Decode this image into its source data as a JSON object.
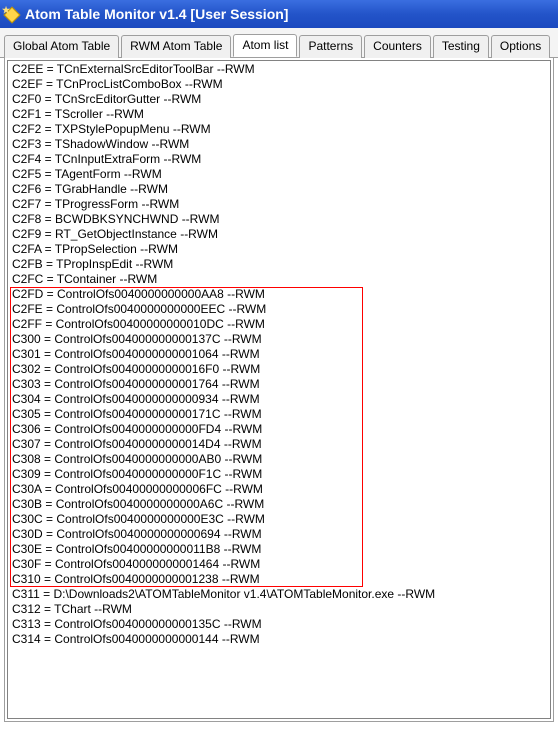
{
  "window": {
    "title": "Atom Table Monitor v1.4 [User Session]"
  },
  "tabs": [
    {
      "label": "Global Atom Table",
      "active": false
    },
    {
      "label": "RWM Atom Table",
      "active": false
    },
    {
      "label": "Atom list",
      "active": true
    },
    {
      "label": "Patterns",
      "active": false
    },
    {
      "label": "Counters",
      "active": false
    },
    {
      "label": "Testing",
      "active": false
    },
    {
      "label": "Options",
      "active": false
    }
  ],
  "highlight": {
    "start": 15,
    "end": 34
  },
  "rows": [
    "C2EE = TCnExternalSrcEditorToolBar  --RWM",
    "C2EF = TCnProcListComboBox  --RWM",
    "C2F0 = TCnSrcEditorGutter  --RWM",
    "C2F1 = TScroller  --RWM",
    "C2F2 = TXPStylePopupMenu  --RWM",
    "C2F3 = TShadowWindow  --RWM",
    "C2F4 = TCnInputExtraForm  --RWM",
    "C2F5 = TAgentForm  --RWM",
    "C2F6 = TGrabHandle  --RWM",
    "C2F7 = TProgressForm  --RWM",
    "C2F8 = BCWDBKSYNCHWND  --RWM",
    "C2F9 = RT_GetObjectInstance  --RWM",
    "C2FA = TPropSelection  --RWM",
    "C2FB = TPropInspEdit  --RWM",
    "C2FC = TContainer  --RWM",
    "C2FD = ControlOfs0040000000000AA8  --RWM",
    "C2FE = ControlOfs0040000000000EEC  --RWM",
    "C2FF = ControlOfs00400000000010DC  --RWM",
    "C300 = ControlOfs004000000000137C  --RWM",
    "C301 = ControlOfs0040000000001064  --RWM",
    "C302 = ControlOfs00400000000016F0  --RWM",
    "C303 = ControlOfs0040000000001764  --RWM",
    "C304 = ControlOfs0040000000000934  --RWM",
    "C305 = ControlOfs004000000000171C  --RWM",
    "C306 = ControlOfs0040000000000FD4  --RWM",
    "C307 = ControlOfs00400000000014D4  --RWM",
    "C308 = ControlOfs0040000000000AB0  --RWM",
    "C309 = ControlOfs0040000000000F1C  --RWM",
    "C30A = ControlOfs00400000000006FC  --RWM",
    "C30B = ControlOfs0040000000000A6C  --RWM",
    "C30C = ControlOfs0040000000000E3C  --RWM",
    "C30D = ControlOfs0040000000000694  --RWM",
    "C30E = ControlOfs00400000000011B8  --RWM",
    "C30F = ControlOfs0040000000001464  --RWM",
    "C310 = ControlOfs0040000000001238  --RWM",
    "C311 = D:\\Downloads2\\ATOMTableMonitor v1.4\\ATOMTableMonitor.exe  --RWM",
    "C312 = TChart  --RWM",
    "C313 = ControlOfs004000000000135C  --RWM",
    "C314 = ControlOfs0040000000000144  --RWM"
  ]
}
